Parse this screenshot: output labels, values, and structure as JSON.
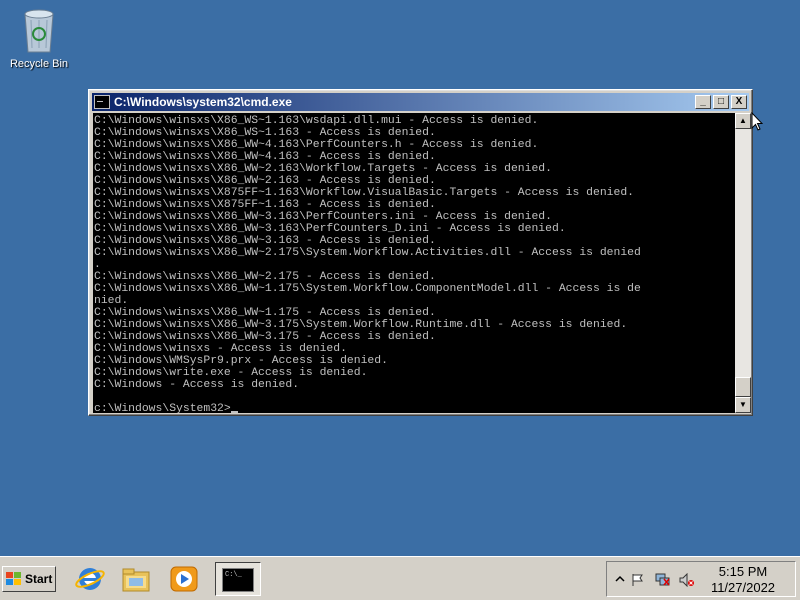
{
  "desktop": {
    "recycle_bin_label": "Recycle Bin"
  },
  "window": {
    "title": "C:\\Windows\\system32\\cmd.exe",
    "controls": {
      "minimize": "_",
      "maximize": "□",
      "close": "X"
    }
  },
  "console": {
    "lines": [
      "C:\\Windows\\winsxs\\X86_WS~1.163\\wsdapi.dll.mui - Access is denied.",
      "C:\\Windows\\winsxs\\X86_WS~1.163 - Access is denied.",
      "C:\\Windows\\winsxs\\X86_WW~4.163\\PerfCounters.h - Access is denied.",
      "C:\\Windows\\winsxs\\X86_WW~4.163 - Access is denied.",
      "C:\\Windows\\winsxs\\X86_WW~2.163\\Workflow.Targets - Access is denied.",
      "C:\\Windows\\winsxs\\X86_WW~2.163 - Access is denied.",
      "C:\\Windows\\winsxs\\X875FF~1.163\\Workflow.VisualBasic.Targets - Access is denied.",
      "C:\\Windows\\winsxs\\X875FF~1.163 - Access is denied.",
      "C:\\Windows\\winsxs\\X86_WW~3.163\\PerfCounters.ini - Access is denied.",
      "C:\\Windows\\winsxs\\X86_WW~3.163\\PerfCounters_D.ini - Access is denied.",
      "C:\\Windows\\winsxs\\X86_WW~3.163 - Access is denied.",
      "C:\\Windows\\winsxs\\X86_WW~2.175\\System.Workflow.Activities.dll - Access is denied",
      ".",
      "C:\\Windows\\winsxs\\X86_WW~2.175 - Access is denied.",
      "C:\\Windows\\winsxs\\X86_WW~1.175\\System.Workflow.ComponentModel.dll - Access is de",
      "nied.",
      "C:\\Windows\\winsxs\\X86_WW~1.175 - Access is denied.",
      "C:\\Windows\\winsxs\\X86_WW~3.175\\System.Workflow.Runtime.dll - Access is denied.",
      "C:\\Windows\\winsxs\\X86_WW~3.175 - Access is denied.",
      "C:\\Windows\\winsxs - Access is denied.",
      "C:\\Windows\\WMSysPr9.prx - Access is denied.",
      "C:\\Windows\\write.exe - Access is denied.",
      "C:\\Windows - Access is denied.",
      "",
      "c:\\Windows\\System32>"
    ]
  },
  "scrollbar": {
    "up_glyph": "▲",
    "down_glyph": "▼",
    "position": 1.0
  },
  "taskbar": {
    "start_label": "Start",
    "quick_launch": [
      "internet-explorer-icon",
      "windows-explorer-icon",
      "media-player-icon"
    ],
    "task_buttons": [
      "cmd-task-icon"
    ],
    "tray_icons": [
      "show-hidden-icon",
      "action-center-flag-icon",
      "network-icon",
      "volume-muted-icon"
    ],
    "clock_time": "5:15 PM",
    "clock_date": "11/27/2022"
  }
}
